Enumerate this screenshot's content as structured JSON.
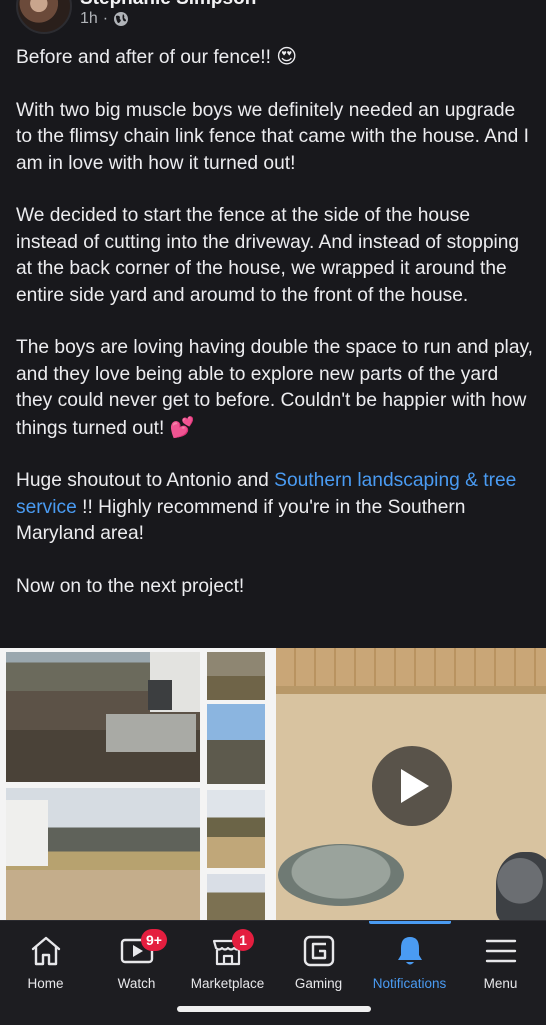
{
  "post": {
    "author": "Stephanie Simpson",
    "time": "1h",
    "separator": "·",
    "privacy_icon": "globe-icon",
    "paragraphs": {
      "p1": {
        "text": "Before and after of our fence!!",
        "emoji": "😍"
      },
      "p2": "With two big muscle boys we definitely needed an upgrade to the flimsy chain link fence that came with the house. And I am in love with how it turned out!",
      "p3": "We decided to start the fence at the side of the house instead of cutting into the driveway. And instead of stopping at the back corner  of the house, we wrapped it around the entire side yard and aroumd to the front of the house.",
      "p4": {
        "text": "The boys are loving having double the space to run and play, and they love being able to explore new parts of the yard they could never get to before. Couldn't be happier with how things turned out!",
        "emoji": "💕"
      },
      "p5": {
        "before": "Huge shoutout to Antonio and ",
        "link": "Southern landscaping & tree service",
        "after": " !! Highly recommend if you're in the Southern Maryland area!"
      },
      "p6": "Now on to the next project!"
    },
    "media": {
      "play_icon": "play-icon"
    }
  },
  "tabbar": {
    "tabs": {
      "home": {
        "label": "Home",
        "icon": "home-icon"
      },
      "watch": {
        "label": "Watch",
        "icon": "video-icon",
        "badge": "9+"
      },
      "marketplace": {
        "label": "Marketplace",
        "icon": "shop-icon",
        "badge": "1"
      },
      "gaming": {
        "label": "Gaming",
        "icon": "gaming-icon"
      },
      "notifications": {
        "label": "Notifications",
        "icon": "bell-icon",
        "active": true
      },
      "menu": {
        "label": "Menu",
        "icon": "hamburger-icon"
      }
    }
  },
  "colors": {
    "background": "#18181c",
    "accent": "#4a9bf2",
    "badge": "#e41e3f",
    "text": "#ececef"
  }
}
